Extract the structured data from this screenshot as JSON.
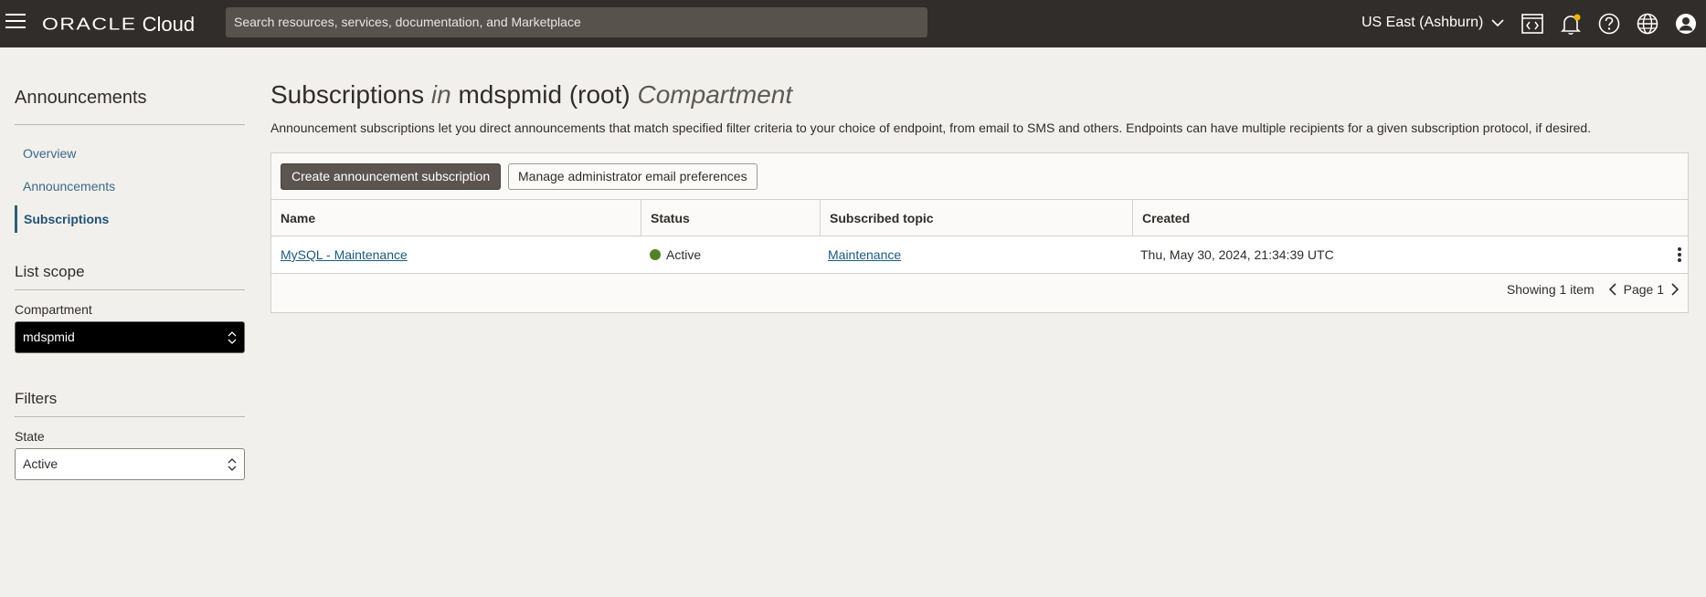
{
  "header": {
    "logo_brand": "ORACLE",
    "logo_product": "Cloud",
    "search_placeholder": "Search resources, services, documentation, and Marketplace",
    "region": "US East (Ashburn)",
    "icons": [
      "menu-icon",
      "code-editor-icon",
      "notification-bell-icon",
      "help-icon",
      "language-globe-icon",
      "user-profile-icon"
    ]
  },
  "sidebar": {
    "title": "Announcements",
    "nav": [
      {
        "label": "Overview",
        "active": false
      },
      {
        "label": "Announcements",
        "active": false
      },
      {
        "label": "Subscriptions",
        "active": true
      }
    ],
    "list_scope": {
      "title": "List scope",
      "compartment_label": "Compartment",
      "compartment_value": "mdspmid"
    },
    "filters": {
      "title": "Filters",
      "state_label": "State",
      "state_value": "Active"
    }
  },
  "main": {
    "title_prefix": "Subscriptions",
    "title_in": "in",
    "title_compartment": "mdspmid (root)",
    "title_suffix": "Compartment",
    "description": "Announcement subscriptions let you direct announcements that match specified filter criteria to your choice of endpoint, from email to SMS and others. Endpoints can have multiple recipients for a given subscription protocol, if desired.",
    "buttons": {
      "create": "Create announcement subscription",
      "manage": "Manage administrator email preferences"
    },
    "table": {
      "columns": [
        "Name",
        "Status",
        "Subscribed topic",
        "Created"
      ],
      "rows": [
        {
          "name": "MySQL - Maintenance",
          "status": "Active",
          "status_color": "#508223",
          "topic": "Maintenance",
          "created": "Thu, May 30, 2024, 21:34:39 UTC"
        }
      ]
    },
    "pagination": {
      "showing": "Showing 1 item",
      "page": "Page 1"
    }
  },
  "colors": {
    "header_bg": "#312d2a",
    "page_bg": "#f2f0ed",
    "primary_button": "#5b544f",
    "link": "#1c5a7f",
    "active_status": "#508223"
  }
}
